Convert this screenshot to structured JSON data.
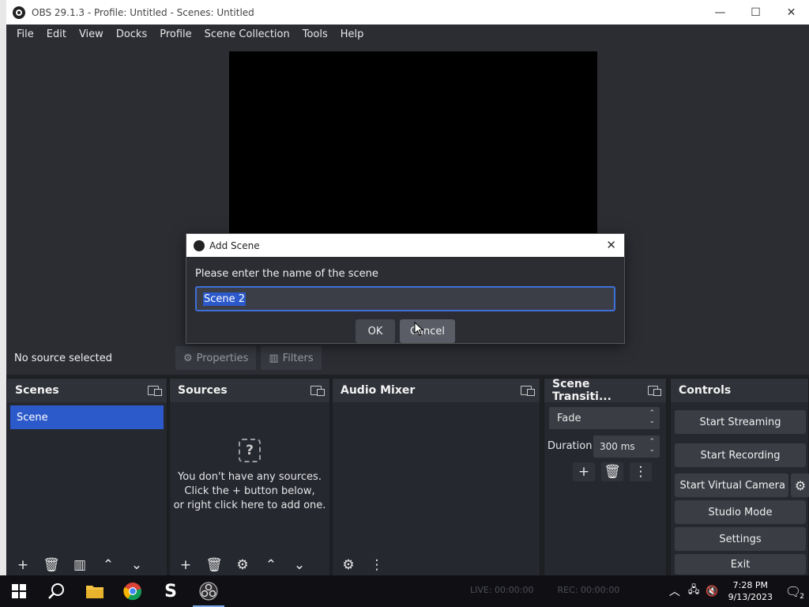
{
  "window": {
    "title": "OBS 29.1.3 - Profile: Untitled - Scenes: Untitled",
    "minimize": "—",
    "maximize": "☐",
    "close": "✕"
  },
  "menu": [
    "File",
    "Edit",
    "View",
    "Docks",
    "Profile",
    "Scene Collection",
    "Tools",
    "Help"
  ],
  "source_bar": {
    "status": "No source selected",
    "properties_label": "Properties",
    "filters_label": "Filters"
  },
  "docks": {
    "scenes": {
      "title": "Scenes",
      "items": [
        "Scene"
      ]
    },
    "sources": {
      "title": "Sources",
      "empty_line1": "You don't have any sources.",
      "empty_line2": "Click the + button below,",
      "empty_line3": "or right click here to add one."
    },
    "audio_mixer": {
      "title": "Audio Mixer"
    },
    "scene_transitions": {
      "title": "Scene Transiti...",
      "transition": "Fade",
      "duration_label": "Duration",
      "duration_value": "300 ms"
    },
    "controls": {
      "title": "Controls",
      "start_streaming": "Start Streaming",
      "start_recording": "Start Recording",
      "start_virtual_camera": "Start Virtual Camera",
      "studio_mode": "Studio Mode",
      "settings": "Settings",
      "exit": "Exit"
    }
  },
  "dialog": {
    "title": "Add Scene",
    "prompt": "Please enter the name of the scene",
    "input_value": "Scene 2",
    "ok_label": "OK",
    "cancel_label": "Cancel"
  },
  "status": {
    "live": "LIVE: 00:00:00",
    "rec": "REC: 00:00:00"
  },
  "taskbar": {
    "time": "7:28 PM",
    "date": "9/13/2023",
    "notifications": "2"
  }
}
